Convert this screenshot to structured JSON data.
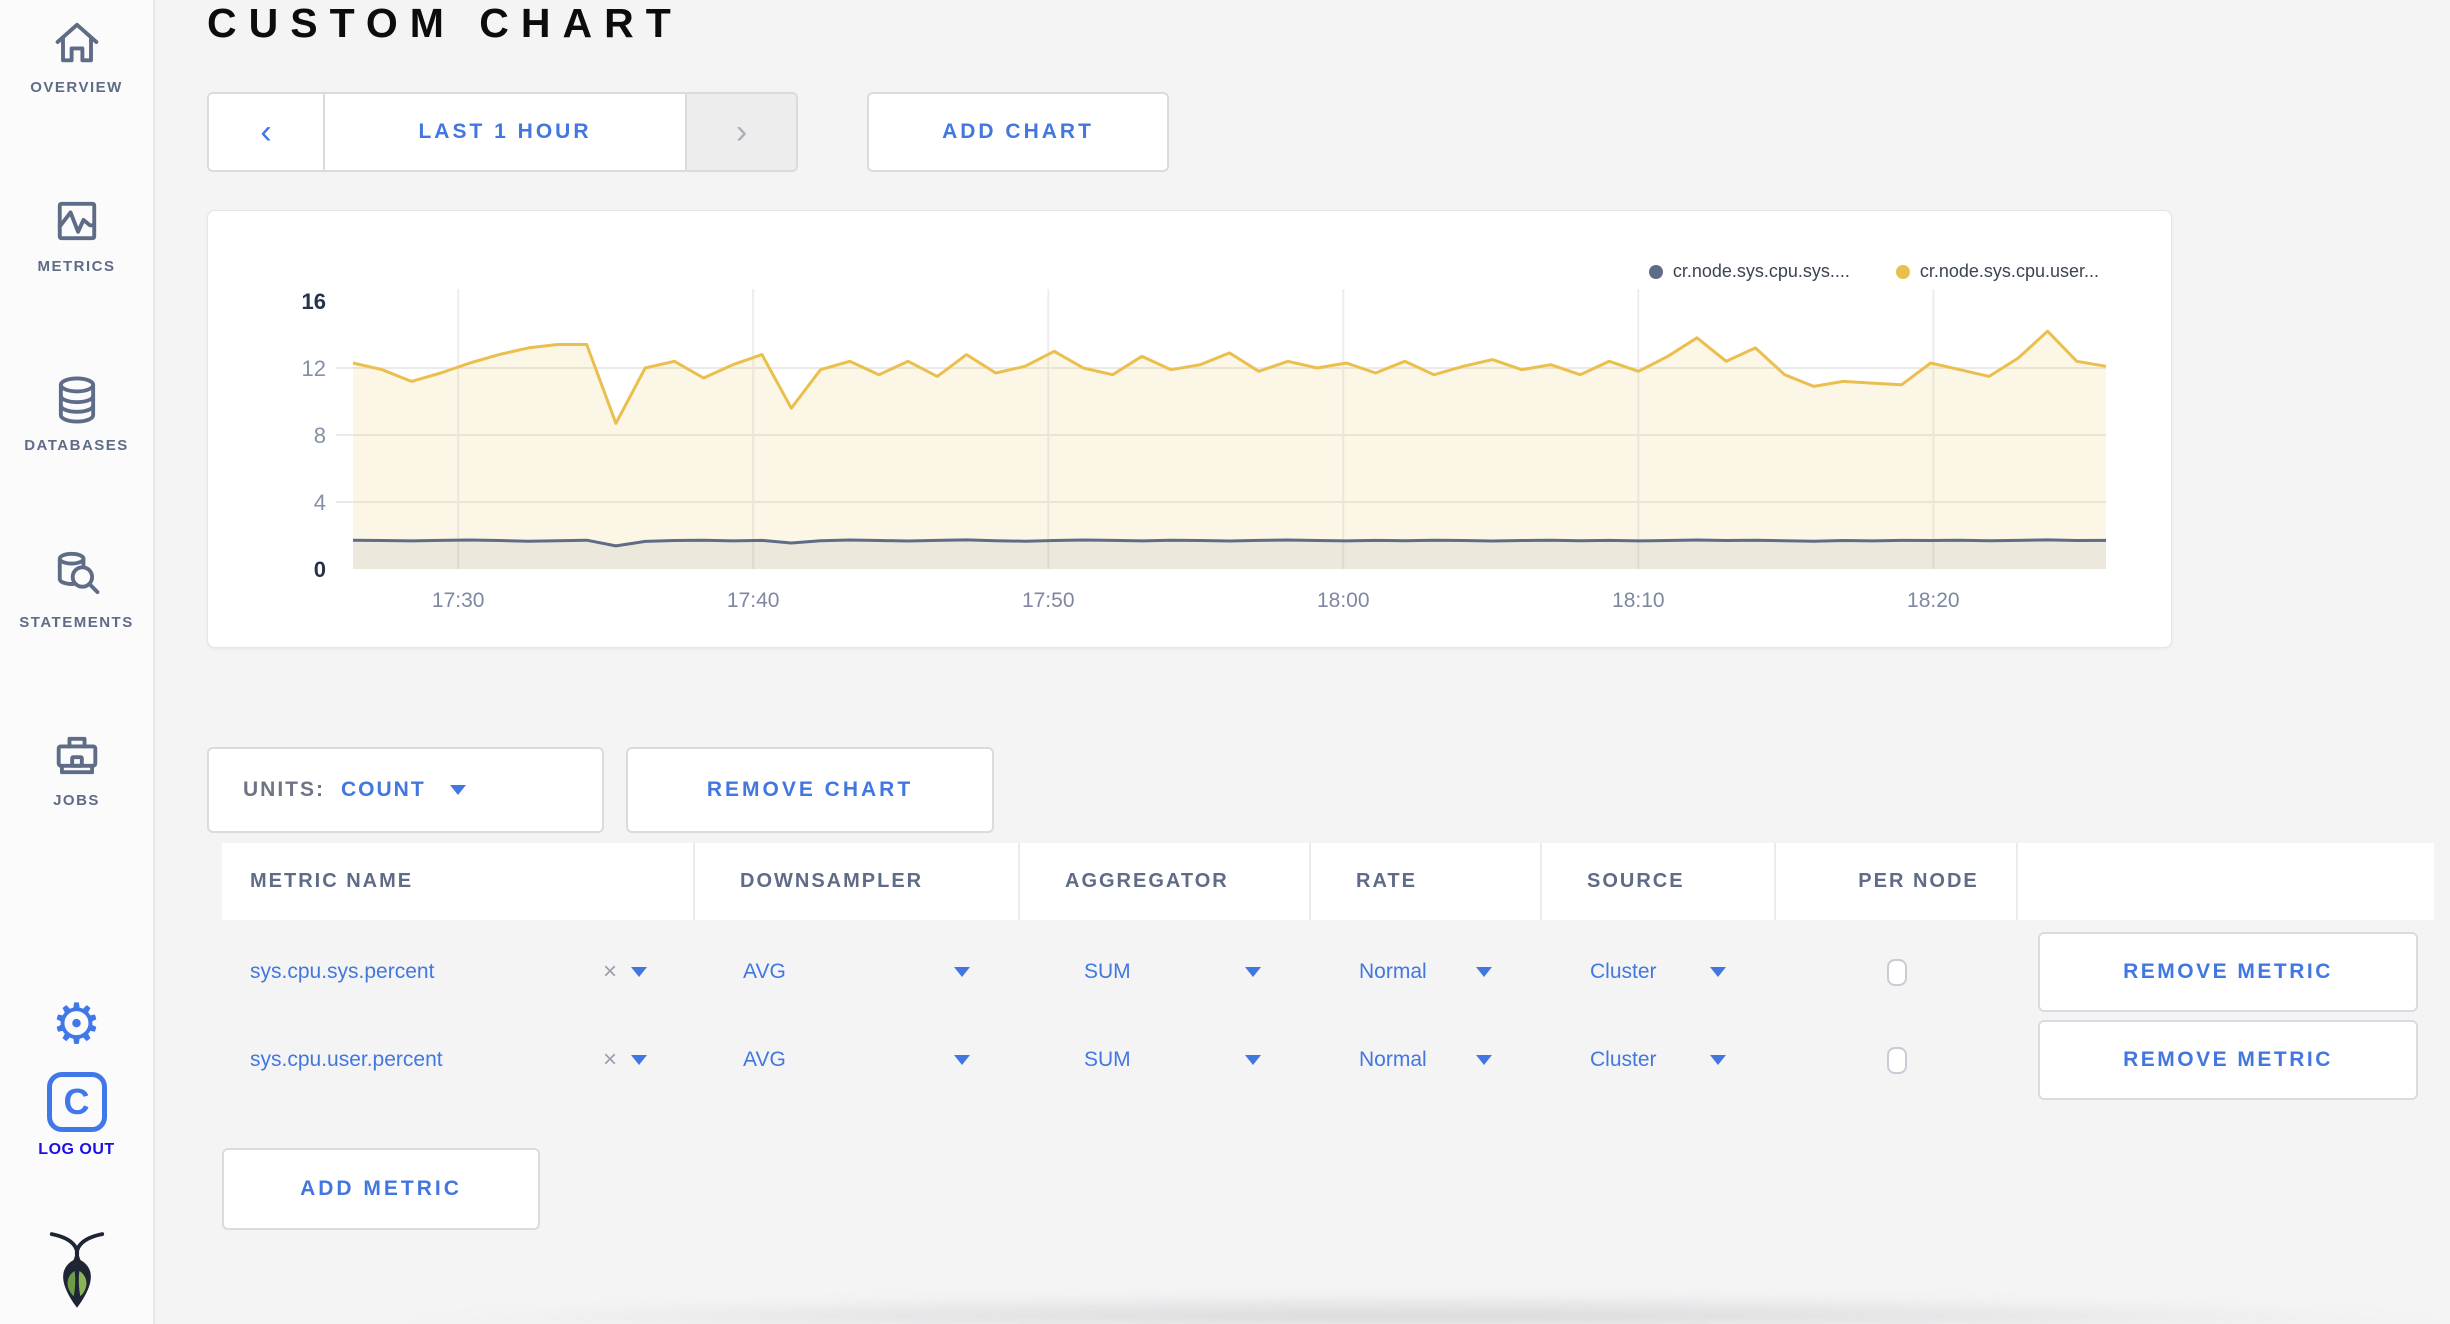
{
  "sidebar": {
    "items": [
      {
        "label": "OVERVIEW",
        "icon": "home-icon"
      },
      {
        "label": "METRICS",
        "icon": "metrics-icon"
      },
      {
        "label": "DATABASES",
        "icon": "databases-icon"
      },
      {
        "label": "STATEMENTS",
        "icon": "statements-icon"
      },
      {
        "label": "JOBS",
        "icon": "jobs-icon"
      }
    ],
    "settings_icon": "gear-icon",
    "logout": {
      "badge": "C",
      "label": "LOG OUT"
    },
    "logo_icon": "cockroach-bug-logo"
  },
  "header": {
    "title": "CUSTOM CHART"
  },
  "time_selector": {
    "prev": "‹",
    "label": "LAST 1 HOUR",
    "next": "›"
  },
  "add_chart_label": "ADD CHART",
  "chart_data": {
    "type": "area",
    "title": "",
    "xlabel": "",
    "ylabel": "",
    "x_ticks": [
      "17:30",
      "17:40",
      "17:50",
      "18:00",
      "18:10",
      "18:20"
    ],
    "y_ticks": [
      0,
      4,
      8,
      12,
      16
    ],
    "ylim": [
      0,
      16
    ],
    "grid": true,
    "legend_position": "top-right",
    "series": [
      {
        "name": "cr.node.sys.cpu.sys....",
        "color": "#5f6c87",
        "fill": "rgba(95,108,135,0.10)",
        "values": [
          1.72,
          1.7,
          1.68,
          1.71,
          1.73,
          1.7,
          1.66,
          1.69,
          1.72,
          1.38,
          1.65,
          1.7,
          1.72,
          1.68,
          1.71,
          1.55,
          1.69,
          1.73,
          1.7,
          1.67,
          1.71,
          1.74,
          1.69,
          1.66,
          1.7,
          1.73,
          1.71,
          1.68,
          1.72,
          1.7,
          1.67,
          1.71,
          1.73,
          1.7,
          1.68,
          1.71,
          1.69,
          1.72,
          1.7,
          1.67,
          1.7,
          1.72,
          1.69,
          1.71,
          1.68,
          1.7,
          1.73,
          1.7,
          1.72,
          1.69,
          1.66,
          1.7,
          1.68,
          1.71,
          1.7,
          1.72,
          1.69,
          1.71,
          1.74,
          1.7,
          1.71
        ]
      },
      {
        "name": "cr.node.sys.cpu.user...",
        "color": "#eabf4d",
        "fill": "rgba(234,191,77,0.14)",
        "values": [
          12.3,
          11.9,
          11.2,
          11.7,
          12.3,
          12.8,
          13.2,
          13.4,
          13.4,
          8.7,
          12.0,
          12.4,
          11.4,
          12.2,
          12.8,
          9.6,
          11.9,
          12.4,
          11.6,
          12.4,
          11.5,
          12.8,
          11.7,
          12.1,
          13.0,
          12.0,
          11.6,
          12.7,
          11.9,
          12.2,
          12.9,
          11.8,
          12.4,
          12.0,
          12.3,
          11.7,
          12.4,
          11.6,
          12.1,
          12.5,
          11.9,
          12.2,
          11.6,
          12.4,
          11.8,
          12.7,
          13.8,
          12.4,
          13.2,
          11.6,
          10.9,
          11.2,
          11.1,
          11.0,
          12.3,
          11.9,
          11.5,
          12.6,
          14.2,
          12.4,
          12.1
        ]
      }
    ]
  },
  "units": {
    "label": "UNITS:",
    "value": "COUNT"
  },
  "remove_chart_label": "REMOVE CHART",
  "metrics_table": {
    "columns": [
      "METRIC NAME",
      "DOWNSAMPLER",
      "AGGREGATOR",
      "RATE",
      "SOURCE",
      "PER NODE",
      ""
    ],
    "rows": [
      {
        "name": "sys.cpu.sys.percent",
        "clear": "×",
        "downsampler": "AVG",
        "aggregator": "SUM",
        "rate": "Normal",
        "source": "Cluster",
        "per_node_checked": false,
        "remove_label": "REMOVE METRIC"
      },
      {
        "name": "sys.cpu.user.percent",
        "clear": "×",
        "downsampler": "AVG",
        "aggregator": "SUM",
        "rate": "Normal",
        "source": "Cluster",
        "per_node_checked": false,
        "remove_label": "REMOVE METRIC"
      }
    ]
  },
  "add_metric_label": "ADD METRIC",
  "colors": {
    "accent_blue": "#4377e0",
    "logout_blue": "#1c10e0",
    "sidebar_slate": "#5f6c87",
    "series_yellow": "#eabf4d",
    "series_slate": "#5f6c87",
    "title_black": "#0c0c0e"
  }
}
